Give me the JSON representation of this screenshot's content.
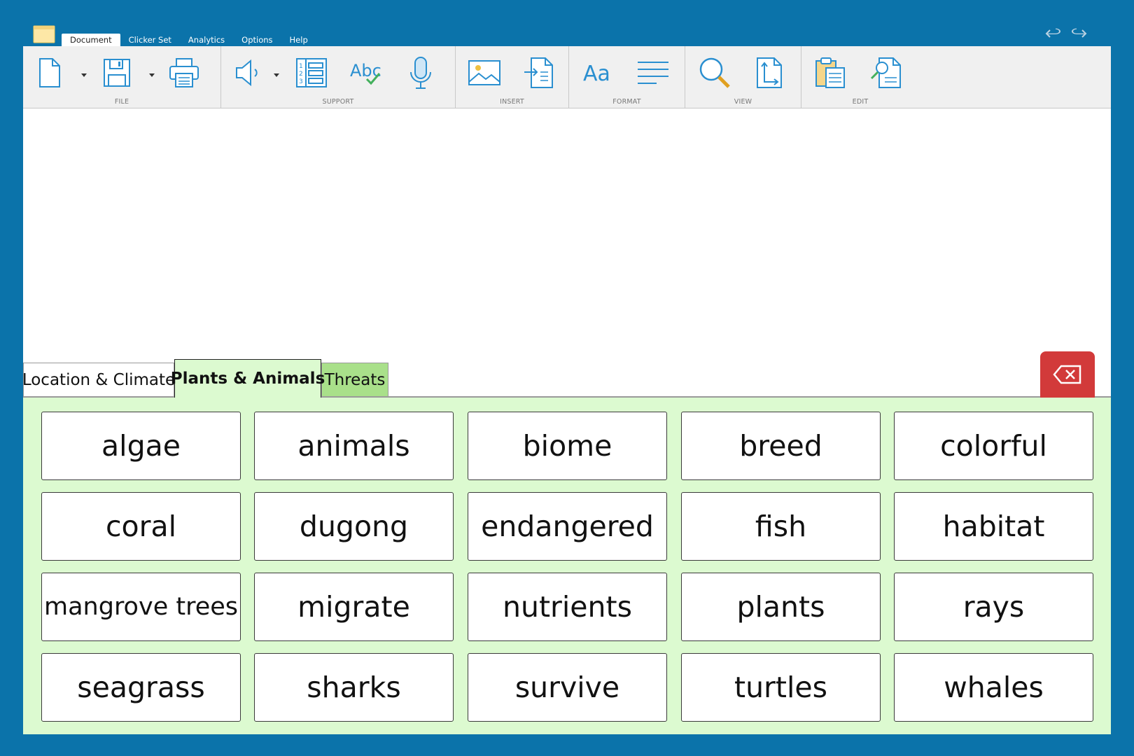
{
  "menu": {
    "tabs": [
      {
        "label": "Document",
        "active": true
      },
      {
        "label": "Clicker Set",
        "active": false
      },
      {
        "label": "Analytics",
        "active": false
      },
      {
        "label": "Options",
        "active": false
      },
      {
        "label": "Help",
        "active": false
      }
    ]
  },
  "ribbon": {
    "groups": {
      "file": "FILE",
      "support": "SUPPORT",
      "insert": "INSERT",
      "format": "FORMAT",
      "view": "VIEW",
      "edit": "EDIT"
    },
    "icons": [
      "new-document-icon",
      "save-icon",
      "print-icon",
      "speech-icon",
      "numbered-list-icon",
      "spell-check-icon",
      "microphone-icon",
      "insert-image-icon",
      "insert-file-icon",
      "font-icon",
      "align-icon",
      "search-icon",
      "page-size-icon",
      "paste-icon",
      "find-replace-icon"
    ]
  },
  "set_tabs": [
    {
      "label": "Location & Climate",
      "active": false,
      "color": "#ffffff"
    },
    {
      "label": "Plants & Animals",
      "active": true,
      "color": "#dcfad0"
    },
    {
      "label": "Threats",
      "active": false,
      "color": "#a9e08a"
    }
  ],
  "grid": {
    "words": [
      "algae",
      "animals",
      "biome",
      "breed",
      "colorful",
      "coral",
      "dugong",
      "endangered",
      "fish",
      "habitat",
      "mangrove trees",
      "migrate",
      "nutrients",
      "plants",
      "rays",
      "seagrass",
      "sharks",
      "survive",
      "turtles",
      "whales"
    ]
  },
  "colors": {
    "background": "#0b73aa",
    "grid_panel": "#dcfad0",
    "backspace": "#d23a3a",
    "icon_blue": "#2a8fd0"
  }
}
